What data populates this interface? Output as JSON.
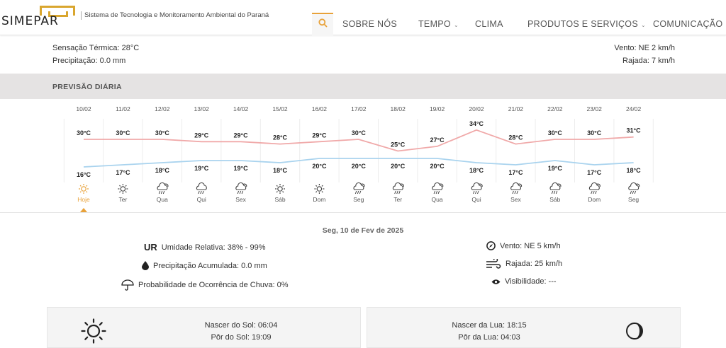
{
  "header": {
    "logo_text": "SIMEPAR",
    "tagline": "Sistema de Tecnologia e Monitoramento Ambiental do Paraná",
    "nav": [
      {
        "label": "SOBRE NÓS",
        "dropdown": false
      },
      {
        "label": "TEMPO",
        "dropdown": true
      },
      {
        "label": "CLIMA",
        "dropdown": false
      },
      {
        "label": "PRODUTOS E SERVIÇOS",
        "dropdown": true
      },
      {
        "label": "COMUNICAÇÃO",
        "dropdown": true
      }
    ],
    "accent_color": "#e8a23a"
  },
  "current": {
    "feels_like": "Sensação Térmica: 28°C",
    "precip": "Precipitação: 0.0 mm",
    "wind": "Vento: NE 2 km/h",
    "gust": "Rajada: 7 km/h"
  },
  "section": {
    "title": "PREVISÃO DIÁRIA"
  },
  "chart_data": {
    "type": "line",
    "x": [
      "10/02",
      "11/02",
      "12/02",
      "13/02",
      "14/02",
      "15/02",
      "16/02",
      "17/02",
      "18/02",
      "19/02",
      "20/02",
      "21/02",
      "22/02",
      "23/02",
      "24/02"
    ],
    "weekdays": [
      "Hoje",
      "Ter",
      "Qua",
      "Qui",
      "Sex",
      "Sáb",
      "Dom",
      "Seg",
      "Ter",
      "Qua",
      "Qui",
      "Sex",
      "Sáb",
      "Dom",
      "Seg"
    ],
    "icons": [
      "sun-icon",
      "sun-icon",
      "rain-sun-icon",
      "rain-cloud-icon",
      "rain-sun-icon",
      "sun-icon",
      "sun-icon",
      "rain-sun-icon",
      "rain-sun-icon",
      "rain-sun-icon",
      "rain-sun-icon",
      "rain-sun-icon",
      "rain-sun-icon",
      "rain-sun-icon",
      "rain-sun-icon"
    ],
    "series": [
      {
        "name": "max",
        "values": [
          30,
          30,
          30,
          29,
          29,
          28,
          29,
          30,
          25,
          27,
          34,
          28,
          30,
          30,
          31
        ],
        "color": "#f0a9a9"
      },
      {
        "name": "min",
        "values": [
          16,
          17,
          18,
          19,
          19,
          18,
          20,
          20,
          20,
          20,
          18,
          17,
          19,
          17,
          18
        ],
        "color": "#a9d3ee"
      }
    ],
    "unit": "°C",
    "selected_index": 0
  },
  "details": {
    "date": "Seg, 10 de Fev de 2025",
    "ur_label": "UR",
    "humidity": "Umidade Relativa: 38% - 99%",
    "precip_acc": "Precipitação Acumulada: 0.0 mm",
    "rain_prob": "Probabilidade de Ocorrência de Chuva: 0%",
    "wind": "Vento: NE 5 km/h",
    "gust": "Rajada: 25 km/h",
    "visibility": "Visibilidade: ---"
  },
  "sun": {
    "rise": "Nascer do Sol: 06:04",
    "set": "Pôr do Sol: 19:09"
  },
  "moon": {
    "rise": "Nascer da Lua: 18:15",
    "set": "Pôr da Lua: 04:03"
  }
}
